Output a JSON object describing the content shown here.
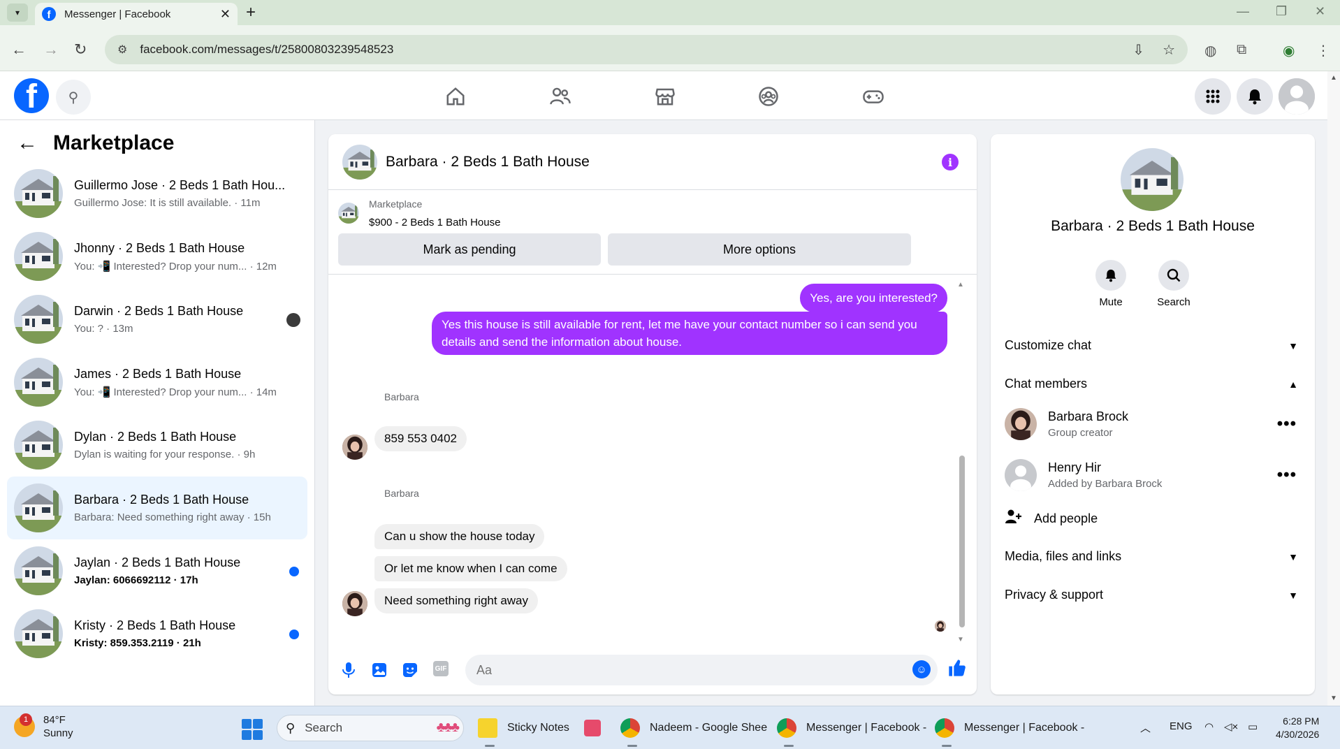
{
  "browser": {
    "tab_title": "Messenger | Facebook",
    "url": "facebook.com/messages/t/25800803239548523"
  },
  "leftcol": {
    "title": "Marketplace",
    "conversations": [
      {
        "name": "Guillermo Jose · 2 Beds 1 Bath Hou...",
        "snippet": "Guillermo Jose: It is still available. · 11m",
        "unread": false
      },
      {
        "name": "Jhonny · 2 Beds 1 Bath House",
        "snippet": "You: 📲 Interested? Drop your num... · 12m",
        "unread": false
      },
      {
        "name": "Darwin · 2 Beds 1 Bath House",
        "snippet": "You: ? · 13m",
        "unread": false
      },
      {
        "name": "James · 2 Beds 1 Bath House",
        "snippet": "You: 📲 Interested? Drop your num... · 14m",
        "unread": false
      },
      {
        "name": "Dylan · 2 Beds 1 Bath House",
        "snippet": "Dylan is waiting for your response. · 9h",
        "unread": false
      },
      {
        "name": "Barbara · 2 Beds 1 Bath House",
        "snippet": "Barbara: Need something right away · 15h",
        "unread": false
      },
      {
        "name": "Jaylan · 2 Beds 1 Bath House",
        "snippet": "Jaylan: 6066692112 · 17h",
        "unread": true
      },
      {
        "name": "Kristy · 2 Beds 1 Bath House",
        "snippet": "Kristy: 859.353.2119 · 21h",
        "unread": true
      }
    ]
  },
  "chat": {
    "title": "Barbara · 2 Beds 1 Bath House",
    "listing_source": "Marketplace",
    "listing": "$900 - 2 Beds 1 Bath House",
    "mark_pending": "Mark as pending",
    "more_options": "More options",
    "outgoing": [
      "Yes, are you interested?",
      "Yes this house is still available for rent, let me have your contact number so i can send you details and send the information about house."
    ],
    "sender": "Barbara",
    "incoming_1": "859 553 0402",
    "incoming_2": [
      "Can u show the house today",
      "Or let me know when I can come",
      "Need something right away"
    ],
    "composer_placeholder": "Aa"
  },
  "rpanel": {
    "title": "Barbara · 2 Beds 1 Bath House",
    "mute": "Mute",
    "search": "Search",
    "customize": "Customize chat",
    "members_header": "Chat members",
    "members": [
      {
        "name": "Barbara Brock",
        "sub": "Group creator"
      },
      {
        "name": "Henry Hir",
        "sub": "Added by Barbara Brock"
      }
    ],
    "add_people": "Add people",
    "media": "Media, files and links",
    "privacy": "Privacy & support"
  },
  "taskbar": {
    "temp": "84°F",
    "condition": "Sunny",
    "weather_badge": "1",
    "search": "Search",
    "apps": [
      "Sticky Notes",
      "Nadeem - Google Shee",
      "Messenger | Facebook -",
      "Messenger | Facebook -"
    ],
    "lang": "ENG",
    "time": "6:28 PM",
    "date": "4/30/2026"
  },
  "colors": {
    "fb_blue": "#0866ff",
    "bubble_purple": "#a033ff",
    "active_conv": "#ebf5ff"
  }
}
